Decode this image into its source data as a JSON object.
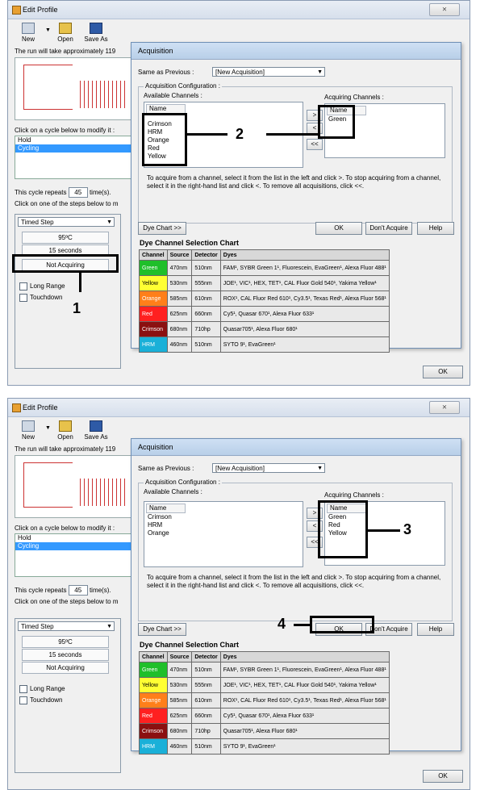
{
  "colors": {
    "green": "#1fbf2a",
    "yellow": "#ffff33",
    "orange": "#ff7f1a",
    "red": "#ff2020",
    "crimson": "#8b1010",
    "hrm": "#1ab0d8"
  },
  "panels": [
    {
      "window_title": "Edit Profile",
      "close_label": "⨯",
      "toolbar": {
        "new": "New",
        "open": "Open",
        "save_as": "Save As"
      },
      "run_hint": "The run will take approximately 119",
      "cycle_prompt": "Click on a cycle below to modify it :",
      "cycles": [
        "Hold",
        "Cycling"
      ],
      "repeat_prefix": "This cycle repeats",
      "repeat_value": "45",
      "repeat_suffix": "time(s).",
      "step_prompt": "Click on one of the steps below to m",
      "step_type": "Timed Step",
      "temperature": "95ºC",
      "duration": "15 seconds",
      "acquiring": "Not Acquiring",
      "long_range": "Long Range",
      "touchdown": "Touchdown",
      "ok": "OK",
      "dialog": {
        "title": "Acquisition",
        "same_as_previous_label": "Same as Previous :",
        "same_as_previous_value": "[New Acquisition]",
        "config_label": "Acquisition Configuration :",
        "available_label": "Available Channels :",
        "acquiring_label": "Acquiring Channels :",
        "name_header": "Name",
        "available": [
          "Crimson",
          "HRM",
          "Orange",
          "Red",
          "Yellow"
        ],
        "acquiring": [
          "Green"
        ],
        "btn_add": ">",
        "btn_remove": "<",
        "btn_remove_all": "<<",
        "instructions": "To acquire from a channel, select it from the list in the left and click >. To stop acquiring from a channel, select it in the right-hand list and click <. To remove all acquisitions, click <<.",
        "dye_chart_btn": "Dye Chart >>",
        "ok": "OK",
        "dont_acquire": "Don't Acquire",
        "help": "Help",
        "chart_title": "Dye Channel Selection Chart"
      },
      "annotations": [
        "2",
        "1"
      ]
    },
    {
      "window_title": "Edit Profile",
      "close_label": "⨯",
      "toolbar": {
        "new": "New",
        "open": "Open",
        "save_as": "Save As"
      },
      "run_hint": "The run will take approximately 119",
      "cycle_prompt": "Click on a cycle below to modify it :",
      "cycles": [
        "Hold",
        "Cycling"
      ],
      "repeat_prefix": "This cycle repeats",
      "repeat_value": "45",
      "repeat_suffix": "time(s).",
      "step_prompt": "Click on one of the steps below to m",
      "step_type": "Timed Step",
      "temperature": "95ºC",
      "duration": "15 seconds",
      "acquiring": "Not Acquiring",
      "long_range": "Long Range",
      "touchdown": "Touchdown",
      "ok": "OK",
      "dialog": {
        "title": "Acquisition",
        "same_as_previous_label": "Same as Previous :",
        "same_as_previous_value": "[New Acquisition]",
        "config_label": "Acquisition Configuration :",
        "available_label": "Available Channels :",
        "acquiring_label": "Acquiring Channels :",
        "name_header": "Name",
        "available": [
          "Crimson",
          "HRM",
          "Orange"
        ],
        "acquiring": [
          "Green",
          "Red",
          "Yellow"
        ],
        "btn_add": ">",
        "btn_remove": "<",
        "btn_remove_all": "<<",
        "instructions": "To acquire from a channel, select it from the list in the left and click >. To stop acquiring from a channel, select it in the right-hand list and click <. To remove all acquisitions, click <<.",
        "dye_chart_btn": "Dye Chart >>",
        "ok": "OK",
        "dont_acquire": "Don't Acquire",
        "help": "Help",
        "chart_title": "Dye Channel Selection Chart"
      },
      "annotations": [
        "3",
        "4"
      ]
    }
  ],
  "dye_chart": {
    "headers": [
      "Channel",
      "Source",
      "Detector",
      "Dyes"
    ],
    "rows": [
      {
        "channel": "Green",
        "color": "#1fbf2a",
        "source": "470nm",
        "detector": "510nm",
        "dyes": "FAM¹, SYBR Green 1¹, Fluorescein, EvaGreen¹, Alexa Fluor 488¹"
      },
      {
        "channel": "Yellow",
        "color": "#ffff33",
        "source": "530nm",
        "detector": "555nm",
        "dyes": "JOE¹, VIC¹, HEX, TET¹, CAL Fluor Gold 540¹, Yakima Yellow¹"
      },
      {
        "channel": "Orange",
        "color": "#ff7f1a",
        "source": "585nm",
        "detector": "610nm",
        "dyes": "ROX¹, CAL Fluor Red 610¹, Cy3.5¹, Texas Red¹, Alexa Fluor 568¹"
      },
      {
        "channel": "Red",
        "color": "#ff2020",
        "source": "625nm",
        "detector": "660nm",
        "dyes": "Cy5¹, Quasar 670¹, Alexa Fluor 633¹"
      },
      {
        "channel": "Crimson",
        "color": "#8b1010",
        "source": "680nm",
        "detector": "710hp",
        "dyes": "Quasar705¹, Alexa Fluor 680¹"
      },
      {
        "channel": "HRM",
        "color": "#1ab0d8",
        "source": "460nm",
        "detector": "510nm",
        "dyes": "SYTO 9¹, EvaGreen¹"
      }
    ]
  }
}
